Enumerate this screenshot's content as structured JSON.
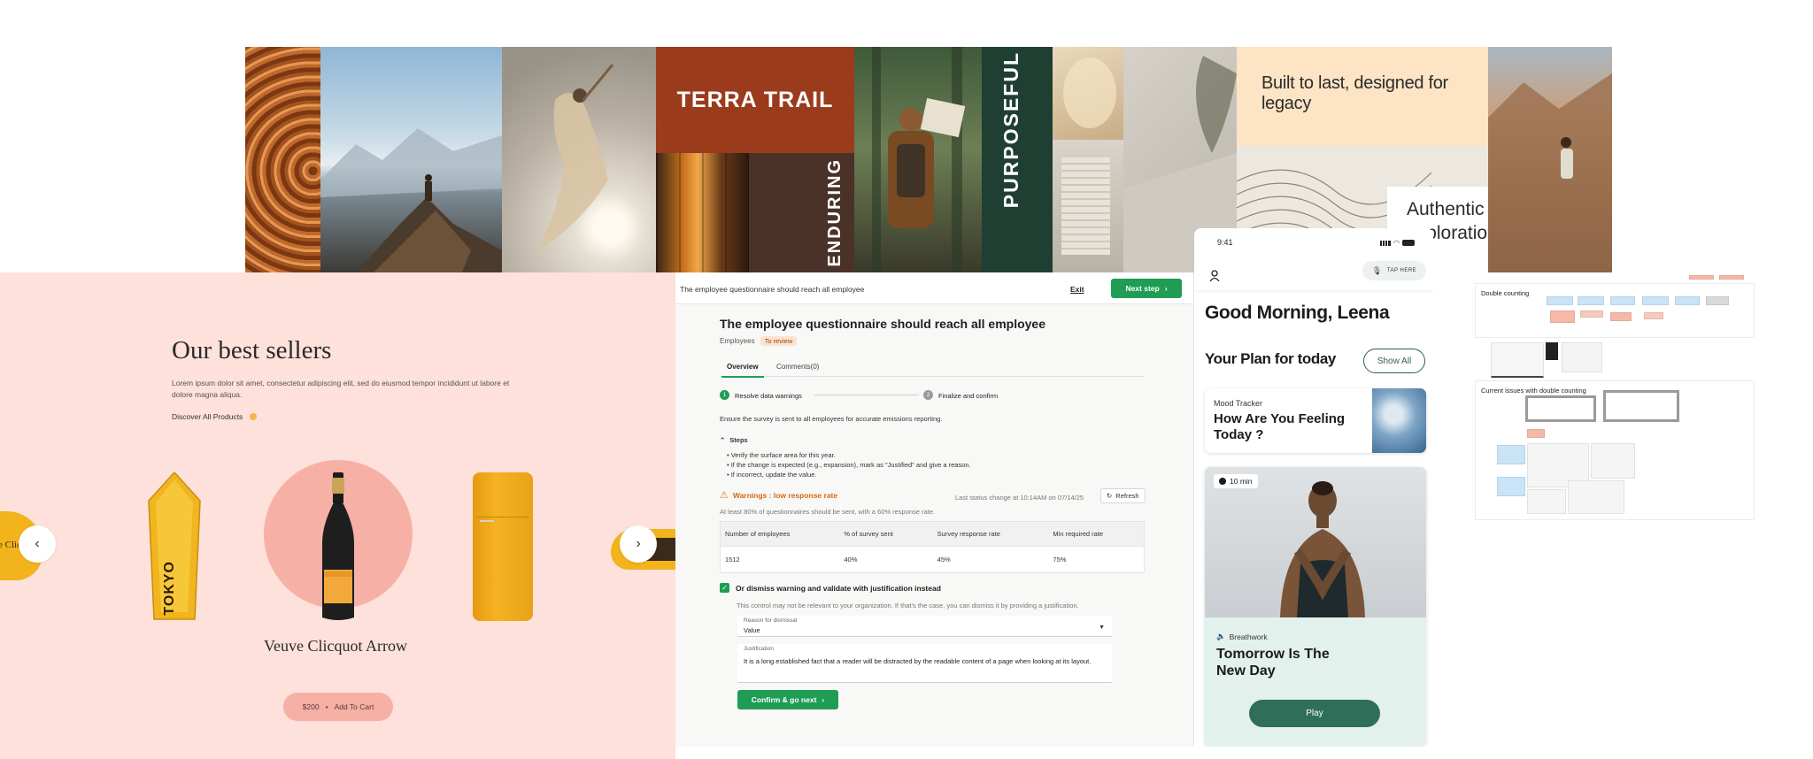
{
  "moodboard": {
    "terra_title": "TERRA TRAIL",
    "enduring": "ENDURING",
    "purposeful": "PURPOSEFUL",
    "quote": "Built to last, designed for legacy",
    "authentic": "Authentic exploration"
  },
  "shop": {
    "heading": "Our best sellers",
    "description": "Lorem ipsum dolor sit amet, consectetur adipiscing elit, sed do eiusmod tempor incididunt ut labore et dolore magna aliqua.",
    "discover_label": "Discover All Products",
    "product_name": "Veuve Clicquot Arrow",
    "price": "$200",
    "separator": "•",
    "add_to_cart": "Add To Cart",
    "sign_text": "TOKYO",
    "cap_text": "e Clicqu"
  },
  "questionnaire": {
    "topbar_title": "The employee questionnaire should reach all employee",
    "exit_label": "Exit",
    "next_step_label": "Next step",
    "title": "The employee questionnaire should reach all employee",
    "category": "Employees",
    "status_badge": "To review",
    "tabs": [
      "Overview",
      "Comments(0)"
    ],
    "steps": [
      {
        "num": "1",
        "label": "Resolve data warnings"
      },
      {
        "num": "2",
        "label": "Finalize and confirm"
      }
    ],
    "intro": "Ensure the survey is sent to all employees for accurate emissions reporting.",
    "steps_heading": "Steps",
    "step_items": [
      "Verify the surface area for this year.",
      "If the change is expected (e.g., expansion), mark as \"Justified\" and give a reason.",
      "If incorrect, update the value."
    ],
    "warning_title": "Warnings : low response rate",
    "warning_desc": "At least 80% of questionnaires should be sent, with a 60% response rate.",
    "last_status": "Last status change at 10:14AM on 07/14/25",
    "refresh_label": "Refresh",
    "table": {
      "headers": [
        "Number of employees",
        "% of survey sent",
        "Survey response rate",
        "Min required rate"
      ],
      "rows": [
        [
          "1512",
          "40%",
          "45%",
          "75%"
        ]
      ]
    },
    "dismiss_label": "Or dismiss warning and validate with justification instead",
    "dismiss_desc": "This control may not be relevant to your organization. If that's the case, you can dismiss it by providing a justification.",
    "reason_label": "Reason for dismissal",
    "reason_value": "Value",
    "justification_label": "Justification",
    "justification_value": "It is a long established fact that a reader will be distracted by the readable content of a page when looking at its layout.",
    "confirm_label": "Confirm & go next"
  },
  "mobile": {
    "time": "9:41",
    "tap_here": "TAP HERE",
    "greeting": "Good Morning, Leena",
    "plan_title": "Your Plan for today",
    "show_all": "Show All",
    "mood_label": "Mood Tracker",
    "mood_title": "How Are You Feeling Today ?",
    "duration": "10 min",
    "breath_label": "Breathwork",
    "breath_title": "Tomorrow Is The New Day",
    "play_label": "Play"
  },
  "board": {
    "frame1_title": "Double counting",
    "frame2_title": "Current issues with double counting"
  },
  "colors": {
    "accent_green": "#1f9d55",
    "shop_bg": "#fde1da",
    "terra": "#9a3b1c",
    "forest": "#1f3f33",
    "mobile_green": "#2f6f5a"
  }
}
